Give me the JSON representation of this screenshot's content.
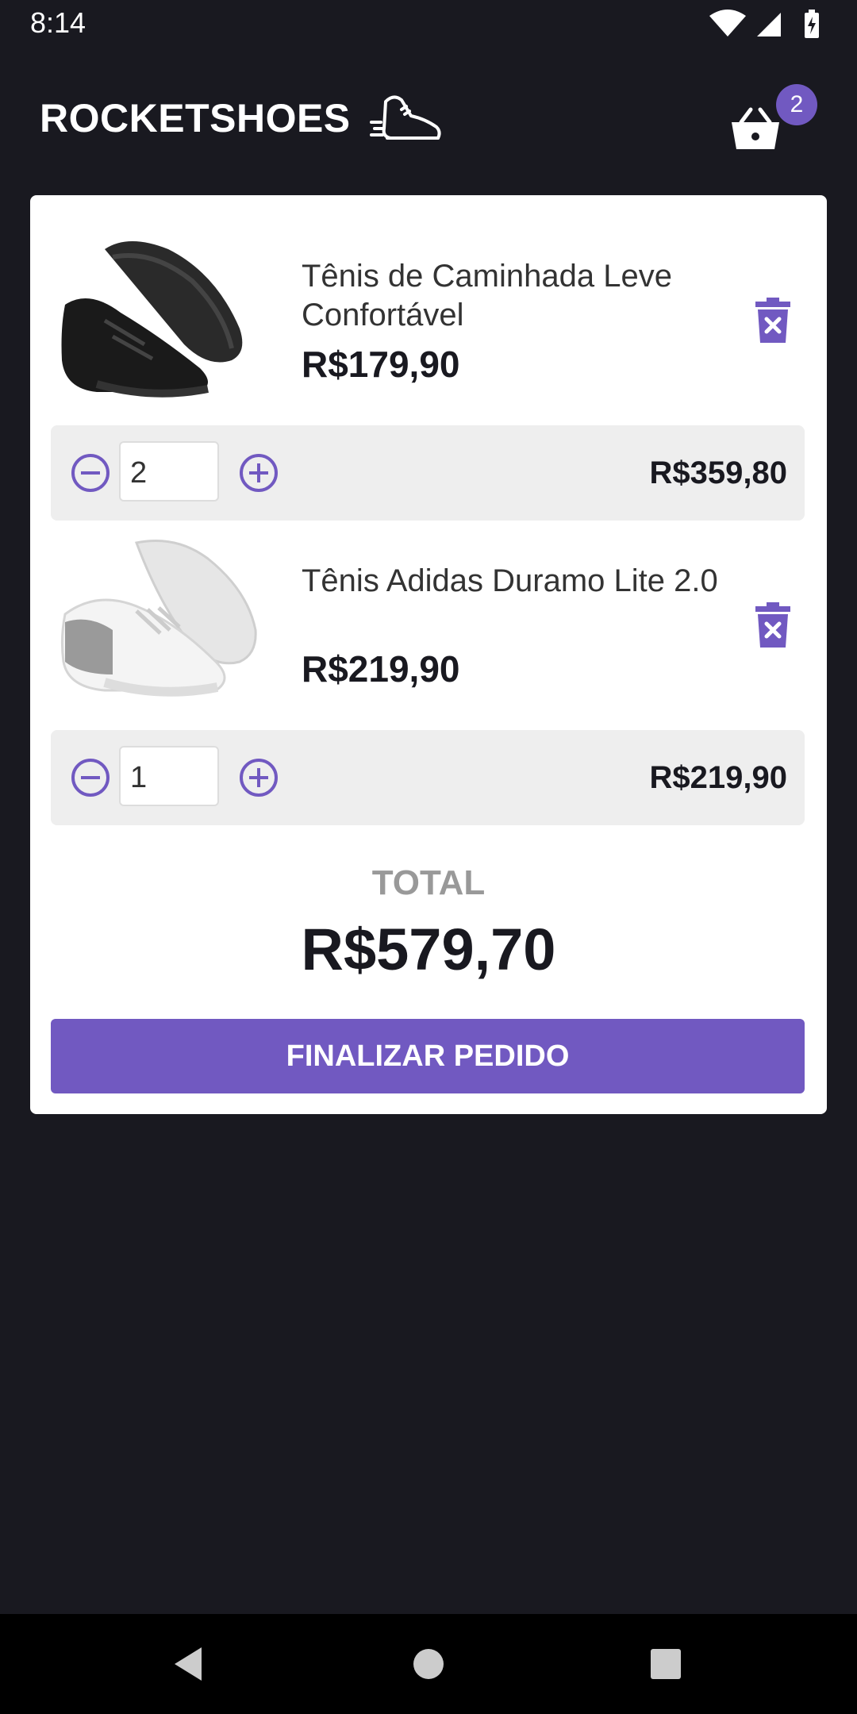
{
  "status_bar": {
    "time": "8:14",
    "icons": [
      "wifi-icon",
      "signal-icon",
      "battery-charging-icon"
    ]
  },
  "header": {
    "logo_text": "ROCKETSHOES",
    "logo_icon": "running-shoe-icon",
    "cart_icon": "basket-icon",
    "cart_count": "2"
  },
  "cart": {
    "items": [
      {
        "title": "Tênis de Caminhada Leve Confortável",
        "price": "R$179,90",
        "quantity": "2",
        "subtotal": "R$359,80",
        "image": "black-sneaker-image"
      },
      {
        "title": "Tênis Adidas Duramo Lite 2.0",
        "price": "R$219,90",
        "quantity": "1",
        "subtotal": "R$219,90",
        "image": "white-sneaker-image"
      }
    ],
    "total_label": "TOTAL",
    "total_value": "R$579,70",
    "checkout_label": "FINALIZAR PEDIDO"
  },
  "nav_bar": {
    "buttons": [
      "back-icon",
      "home-icon",
      "recents-icon"
    ]
  },
  "colors": {
    "background": "#191920",
    "accent": "#7159c1",
    "panel": "#ffffff",
    "quantity_bar": "#eeeeee"
  }
}
